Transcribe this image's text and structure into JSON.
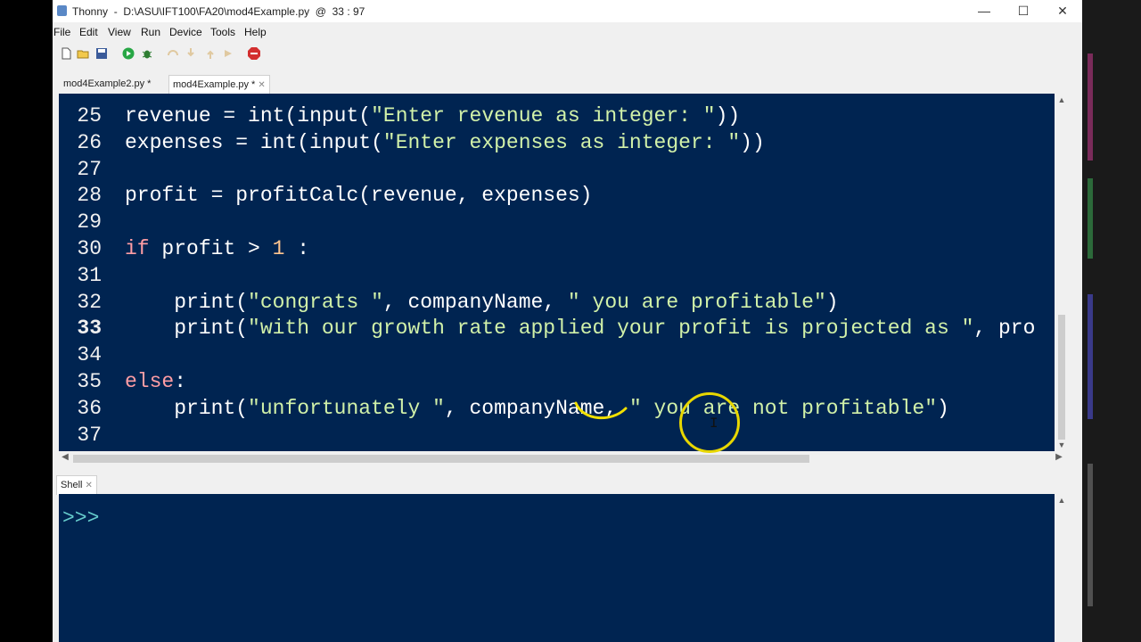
{
  "window": {
    "title": "Thonny  -  D:\\ASU\\IFT100\\FA20\\mod4Example.py  @  33 : 97",
    "minimize": "—",
    "maximize": "☐",
    "close": "✕"
  },
  "menu": [
    "File",
    "Edit",
    "View",
    "Run",
    "Device",
    "Tools",
    "Help"
  ],
  "toolbar": {
    "icons": [
      "new-file-icon",
      "open-file-icon",
      "save-icon",
      "run-icon",
      "debug-icon",
      "step-over-icon",
      "step-into-icon",
      "step-out-icon",
      "resume-icon",
      "stop-icon"
    ]
  },
  "tabs": [
    {
      "label": "mod4Example2.py *",
      "active": false
    },
    {
      "label": "mod4Example.py *",
      "active": true
    }
  ],
  "editor": {
    "current_line": 33,
    "lines": [
      {
        "n": "25",
        "code": "revenue = int(input(\"Enter revenue as integer: \"))"
      },
      {
        "n": "26",
        "code": "expenses = int(input(\"Enter expenses as integer: \"))"
      },
      {
        "n": "27",
        "code": ""
      },
      {
        "n": "28",
        "code": "profit = profitCalc(revenue, expenses)"
      },
      {
        "n": "29",
        "code": ""
      },
      {
        "n": "30",
        "code": "if profit > 1 :"
      },
      {
        "n": "31",
        "code": ""
      },
      {
        "n": "32",
        "code": "    print(\"congrats \", companyName, \" you are profitable\")"
      },
      {
        "n": "33",
        "code": "    print(\"with our growth rate applied your profit is projected as \", pro"
      },
      {
        "n": "34",
        "code": ""
      },
      {
        "n": "35",
        "code": "else:"
      },
      {
        "n": "36",
        "code": "    print(\"unfortunately \", companyName, \" you are not profitable\")"
      },
      {
        "n": "37",
        "code": ""
      }
    ]
  },
  "shell": {
    "tab_label": "Shell",
    "prompt": ">>>"
  },
  "colors": {
    "editor_bg": "#002451",
    "keyword": "#ff9da4",
    "string": "#d1f1a9",
    "number": "#ffc58f",
    "prompt": "#66cccc",
    "cursor_highlight": "#e8d700"
  }
}
